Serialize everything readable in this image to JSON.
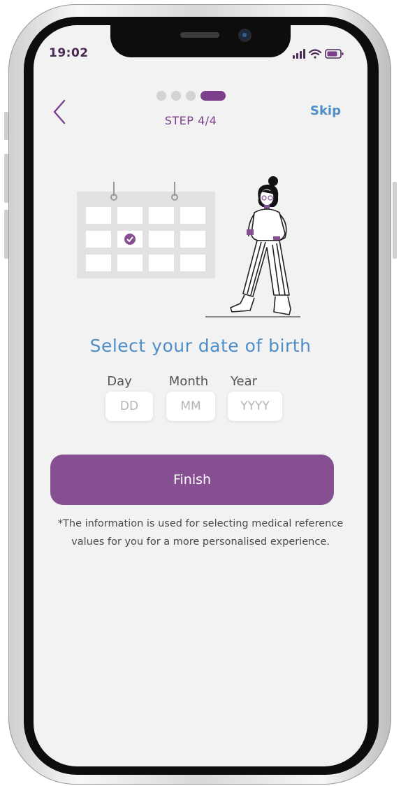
{
  "status_bar": {
    "time": "19:02"
  },
  "header": {
    "step_label": "STEP 4/4",
    "skip_label": "Skip",
    "progress": {
      "current_step": 4,
      "total_steps": 4
    }
  },
  "main": {
    "title": "Select your date of birth",
    "fields": {
      "day": {
        "label": "Day",
        "placeholder": "DD",
        "value": ""
      },
      "month": {
        "label": "Month",
        "placeholder": "MM",
        "value": ""
      },
      "year": {
        "label": "Year",
        "placeholder": "YYYY",
        "value": ""
      }
    },
    "finish_label": "Finish",
    "note_line1": "*The information is used for selecting medical reference",
    "note_line2": "values for you for a more personalised experience."
  },
  "colors": {
    "accent_purple": "#864f91",
    "link_blue": "#4f8ec8",
    "background": "#f2f2f2"
  },
  "icons": [
    "back-chevron-icon",
    "signal-icon",
    "wifi-icon",
    "battery-icon",
    "calendar-illustration",
    "checkmark-icon",
    "woman-illustration"
  ]
}
